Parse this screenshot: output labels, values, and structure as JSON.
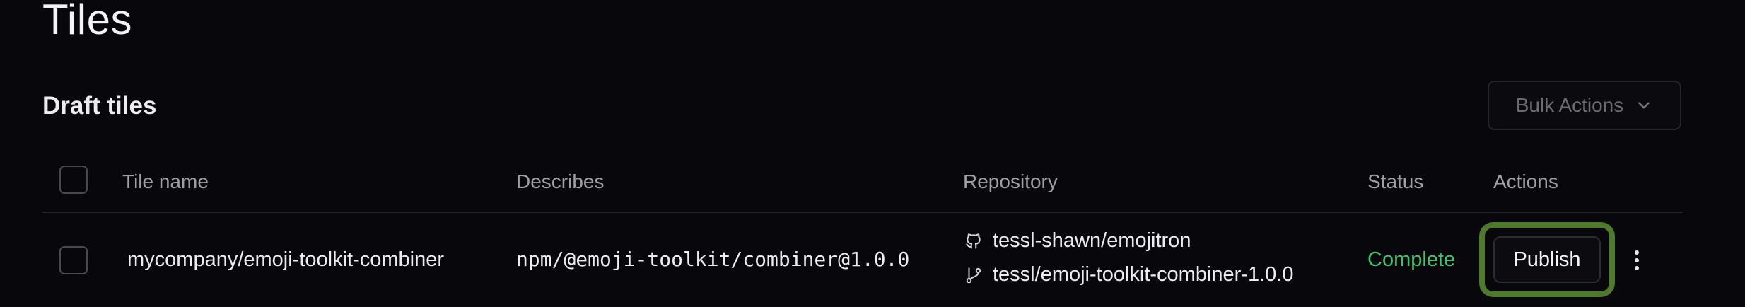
{
  "page": {
    "title": "Tiles"
  },
  "section": {
    "title": "Draft tiles",
    "bulk_actions_label": "Bulk Actions"
  },
  "table": {
    "columns": {
      "tile_name": "Tile name",
      "describes": "Describes",
      "repository": "Repository",
      "status": "Status",
      "actions": "Actions"
    },
    "rows": [
      {
        "tile_name": "mycompany/emoji-toolkit-combiner",
        "describes": "npm/@emoji-toolkit/combiner@1.0.0",
        "repository": "tessl-shawn/emojitron",
        "branch": "tessl/emoji-toolkit-combiner-1.0.0",
        "status": "Complete",
        "action_label": "Publish"
      }
    ]
  },
  "colors": {
    "background": "#08070b",
    "status_complete": "#3ec46d",
    "highlight": "#4f7a2b",
    "border": "#26252b"
  },
  "icons": {
    "bulk_actions": "chevron-down-icon",
    "repository": "github-icon",
    "branch": "git-branch-icon",
    "more": "more-vertical-icon"
  }
}
